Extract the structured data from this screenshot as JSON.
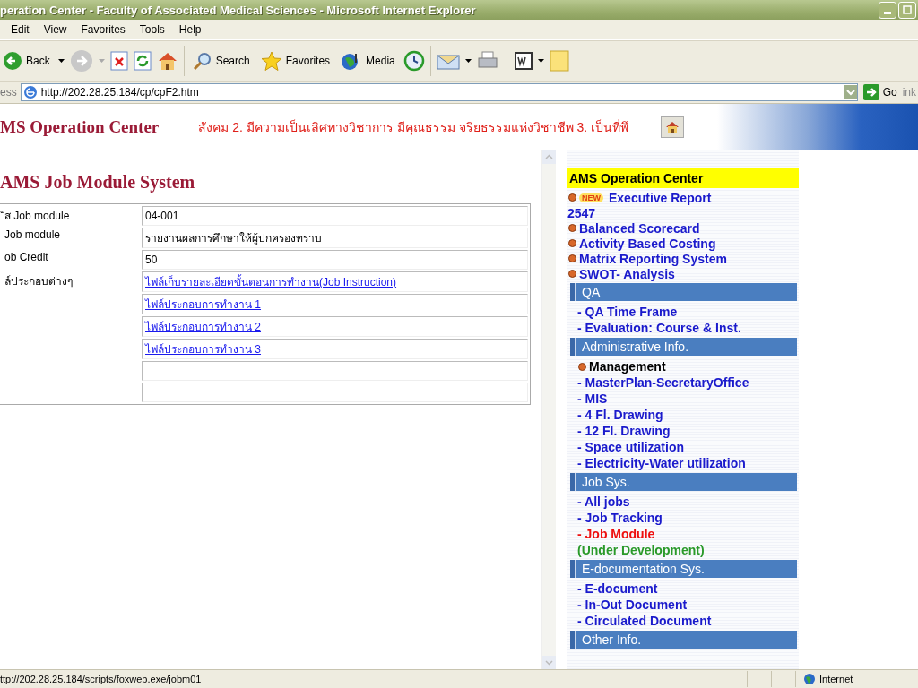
{
  "window": {
    "title": "peration Center - Faculty of Associated Medical Sciences - Microsoft Internet Explorer"
  },
  "menu": [
    "Edit",
    "View",
    "Favorites",
    "Tools",
    "Help"
  ],
  "toolbar": {
    "back": "Back",
    "search": "Search",
    "favorites": "Favorites",
    "media": "Media"
  },
  "address_bar": {
    "label": "ess",
    "url": "http://202.28.25.184/cp/cpF2.htm",
    "go": "Go",
    "links": "ink"
  },
  "banner": {
    "title": "MS Operation Center",
    "motto": "สังคม 2. มีความเป็นเลิศทางวิชาการ มีคุณธรรม จริยธรรมแห่งวิชาชีพ 3. เป็นที่พึ"
  },
  "page": {
    "heading": "AMS Job Module System",
    "rows": [
      {
        "label": "ัส Job module",
        "values": [
          {
            "kind": "text",
            "text": "04-001"
          }
        ]
      },
      {
        "label": "Job module",
        "values": [
          {
            "kind": "text",
            "text": "รายงานผลการศึกษาให้ผู้ปกครองทราบ"
          }
        ]
      },
      {
        "label": "ob Credit",
        "values": [
          {
            "kind": "text",
            "text": "50"
          }
        ]
      },
      {
        "label": "ล์ประกอบต่างๆ",
        "values": [
          {
            "kind": "link",
            "text": "ไฟล์เก็บรายละเอียดขั้นตอนการทำงาน(Job Instruction)"
          },
          {
            "kind": "link",
            "text": "ไฟล์ประกอบการทำงาน 1"
          },
          {
            "kind": "link",
            "text": "ไฟล์ประกอบการทำงาน 2"
          },
          {
            "kind": "link",
            "text": "ไฟล์ประกอบการทำงาน 3"
          },
          {
            "kind": "empty"
          },
          {
            "kind": "empty"
          }
        ]
      }
    ]
  },
  "sidebar": {
    "header": "AMS Operation Center",
    "items": [
      {
        "kind": "link",
        "badge": "NEW",
        "text": "Executive Report",
        "line2": "2547"
      },
      {
        "kind": "link",
        "text": "Balanced Scorecard"
      },
      {
        "kind": "link",
        "text": "Activity Based Costing"
      },
      {
        "kind": "link",
        "text": "Matrix Reporting System"
      },
      {
        "kind": "link",
        "text": "SWOT- Analysis"
      },
      {
        "kind": "section",
        "text": "QA"
      },
      {
        "kind": "sublink",
        "text": "- QA Time Frame",
        "selected": false
      },
      {
        "kind": "sublink",
        "text": "- Evaluation: Course & Inst.",
        "selected": false
      },
      {
        "kind": "section",
        "text": "Administrative Info."
      },
      {
        "kind": "label",
        "text": "Management"
      },
      {
        "kind": "sublink",
        "text": "- MasterPlan-SecretaryOffice",
        "selected": false
      },
      {
        "kind": "sublink",
        "text": "- MIS",
        "selected": false
      },
      {
        "kind": "sublink",
        "text": "- 4 Fl. Drawing",
        "selected": false
      },
      {
        "kind": "sublink",
        "text": "- 12 Fl. Drawing",
        "selected": false
      },
      {
        "kind": "sublink",
        "text": "- Space utilization",
        "selected": false
      },
      {
        "kind": "sublink",
        "text": "- Electricity-Water utilization",
        "selected": false
      },
      {
        "kind": "section",
        "text": "Job Sys."
      },
      {
        "kind": "sublink",
        "text": "- All jobs",
        "selected": false
      },
      {
        "kind": "sublink",
        "text": "- Job Tracking",
        "selected": false
      },
      {
        "kind": "sublink",
        "text": "- Job Module",
        "selected": true
      },
      {
        "kind": "note",
        "text": "(Under Development)"
      },
      {
        "kind": "section",
        "text": "E-documentation Sys."
      },
      {
        "kind": "sublink",
        "text": "- E-document",
        "selected": false
      },
      {
        "kind": "sublink",
        "text": "- In-Out Document",
        "selected": false
      },
      {
        "kind": "sublink",
        "text": "- Circulated Document",
        "selected": false
      },
      {
        "kind": "section",
        "text": "Other Info."
      }
    ]
  },
  "status_bar": {
    "url": "ttp://202.28.25.184/scripts/foxweb.exe/jobm01",
    "zone": "Internet"
  }
}
